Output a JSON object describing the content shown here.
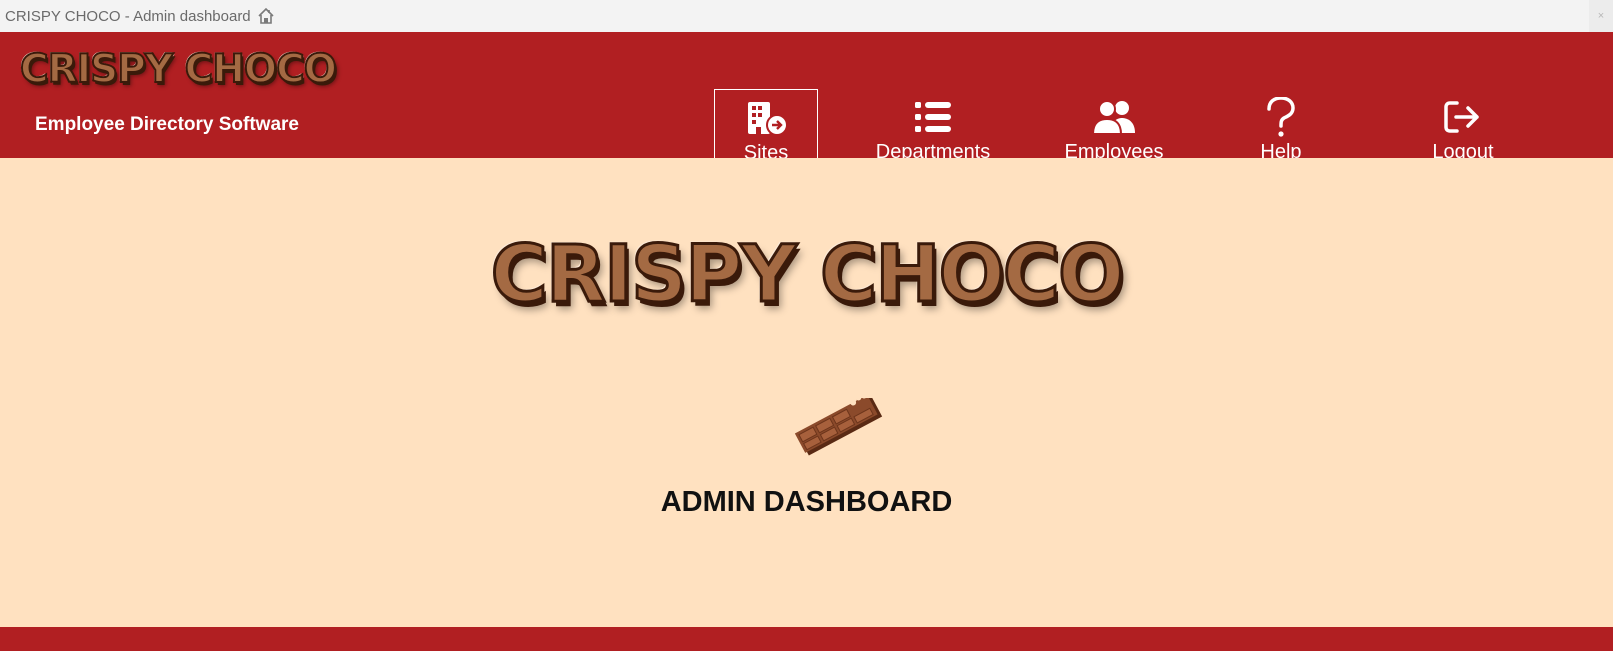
{
  "window": {
    "title": "CRISPY CHOCO - Admin dashboard",
    "close_symbol": "×"
  },
  "header": {
    "logo_text": "CRISPY CHOCO",
    "subtitle": "Employee Directory Software",
    "nav": [
      {
        "label": "Sites",
        "icon": "building-arrow-icon",
        "active": true
      },
      {
        "label": "Departments",
        "icon": "list-icon",
        "active": false
      },
      {
        "label": "Employees",
        "icon": "users-icon",
        "active": false
      },
      {
        "label": "Help",
        "icon": "question-icon",
        "active": false
      },
      {
        "label": "Logout",
        "icon": "logout-icon",
        "active": false
      }
    ]
  },
  "main": {
    "logo_text": "CRISPY CHOCO",
    "heading": "ADMIN DASHBOARD"
  },
  "colors": {
    "header_bg": "#b11f22",
    "page_bg": "#ffe1c0",
    "chocolate": "#a46a43",
    "chocolate_dark": "#3a1a0a"
  }
}
